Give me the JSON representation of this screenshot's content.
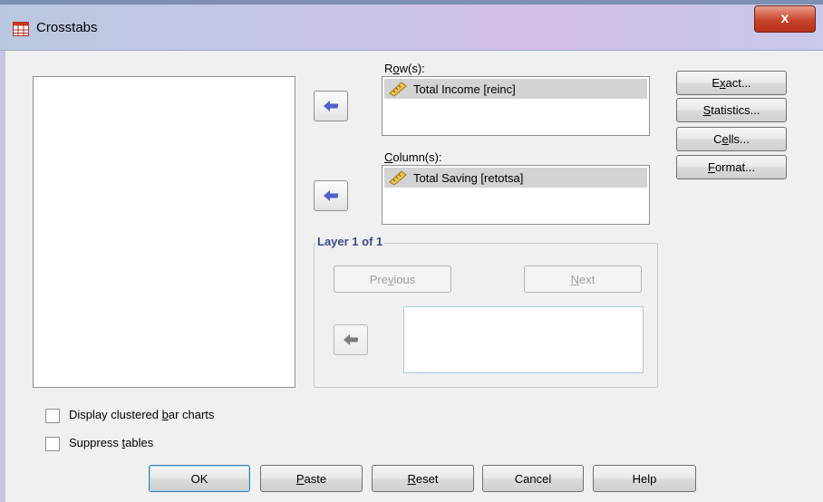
{
  "window": {
    "title": "Crosstabs",
    "close_symbol": "x"
  },
  "source_list": {
    "items": []
  },
  "rows": {
    "label_pre": "R",
    "label_u": "o",
    "label_post": "w(s):",
    "items": [
      {
        "label": "Total Income [reinc]",
        "icon": "scale-variable-icon"
      }
    ]
  },
  "columns": {
    "label_pre": "",
    "label_u": "C",
    "label_post": "olumn(s):",
    "items": [
      {
        "label": "Total Saving [retotsa]",
        "icon": "scale-variable-icon"
      }
    ]
  },
  "layer": {
    "title": "Layer 1 of 1",
    "previous_pre": "Pre",
    "previous_u": "v",
    "previous_post": "ious",
    "next_pre": "",
    "next_u": "N",
    "next_post": "ext"
  },
  "side_buttons": {
    "exact_pre": "E",
    "exact_u": "x",
    "exact_post": "act...",
    "statistics_pre": "",
    "statistics_u": "S",
    "statistics_post": "tatistics...",
    "cells_pre": "C",
    "cells_u": "e",
    "cells_post": "lls...",
    "format_pre": "",
    "format_u": "F",
    "format_post": "ormat..."
  },
  "options": {
    "clustered_pre": "Display clustered ",
    "clustered_u": "b",
    "clustered_post": "ar charts",
    "clustered_checked": false,
    "suppress_pre": "Suppress ",
    "suppress_u": "t",
    "suppress_post": "ables",
    "suppress_checked": false
  },
  "footer": {
    "ok": "OK",
    "paste_pre": "",
    "paste_u": "P",
    "paste_post": "aste",
    "reset_pre": "",
    "reset_u": "R",
    "reset_post": "eset",
    "cancel": "Cancel",
    "help": "Help"
  },
  "colors": {
    "arrow": "#5060c8",
    "arrow_disabled": "#7a7a7a",
    "group_title": "#3a4a8a"
  }
}
